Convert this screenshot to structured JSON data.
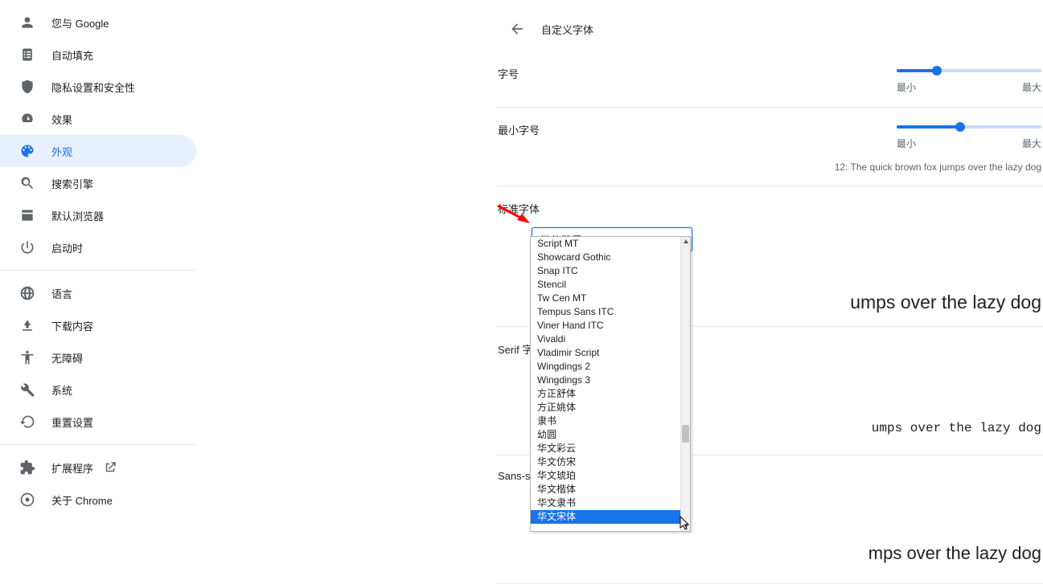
{
  "sidebar": {
    "items": [
      {
        "label": "您与 Google"
      },
      {
        "label": "自动填充"
      },
      {
        "label": "隐私设置和安全性"
      },
      {
        "label": "效果"
      },
      {
        "label": "外观"
      },
      {
        "label": "搜索引擎"
      },
      {
        "label": "默认浏览器"
      },
      {
        "label": "启动时"
      }
    ],
    "items2": [
      {
        "label": "语言"
      },
      {
        "label": "下载内容"
      },
      {
        "label": "无障碍"
      },
      {
        "label": "系统"
      },
      {
        "label": "重置设置"
      }
    ],
    "items3": [
      {
        "label": "扩展程序"
      },
      {
        "label": "关于 Chrome"
      }
    ]
  },
  "header": {
    "title": "自定义字体"
  },
  "slider1": {
    "label": "字号",
    "min": "最小",
    "max": "最大",
    "fill_pct": 28
  },
  "slider2": {
    "label": "最小字号",
    "min": "最小",
    "max": "最大",
    "fill_pct": 44,
    "preview": "12: The quick brown fox jumps over the lazy dog"
  },
  "standard_font": {
    "label": "标准字体",
    "selected": "微软雅黑",
    "preview": "umps over the lazy dog"
  },
  "serif": {
    "label": "Serif 字",
    "preview": "umps over the lazy dog"
  },
  "sans": {
    "label": "Sans-s",
    "preview": "mps over the lazy dog"
  },
  "dropdown": {
    "options": [
      "Script MT",
      "Showcard Gothic",
      "Snap ITC",
      "Stencil",
      "Tw Cen MT",
      "Tempus Sans ITC",
      "Viner Hand ITC",
      "Vivaldi",
      "Vladimir Script",
      "Wingdings 2",
      "Wingdings 3",
      "方正舒体",
      "方正姚体",
      "隶书",
      "幼圆",
      "华文彩云",
      "华文仿宋",
      "华文琥珀",
      "华文楷体",
      "华文隶书",
      "华文宋体"
    ],
    "highlight_index": 20,
    "scroll_thumb_top_pct": 64,
    "scroll_thumb_height_pct": 6
  }
}
